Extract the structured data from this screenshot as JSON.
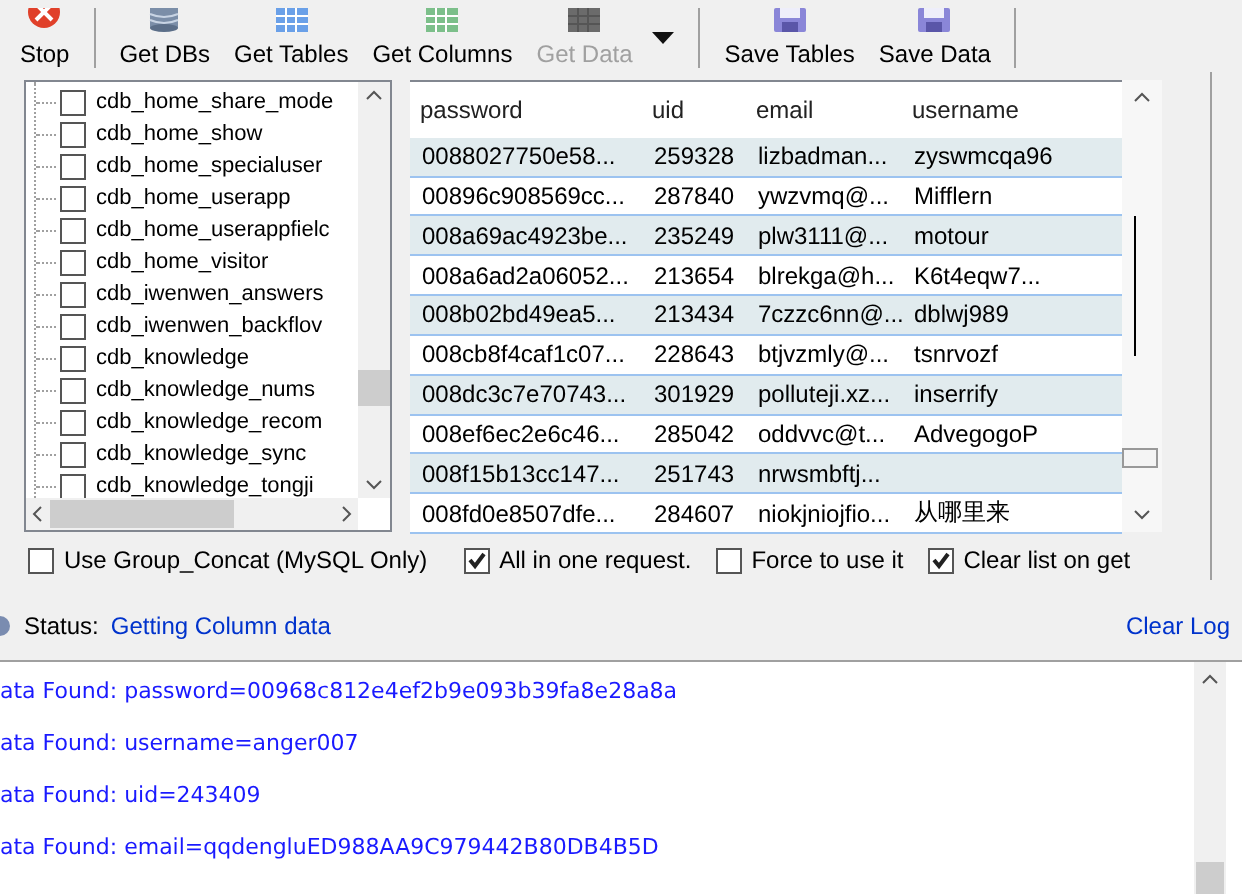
{
  "toolbar": {
    "buttons": [
      {
        "label": "Stop",
        "disabled": false
      },
      {
        "label": "Get DBs",
        "disabled": false
      },
      {
        "label": "Get Tables",
        "disabled": false
      },
      {
        "label": "Get Columns",
        "disabled": false
      },
      {
        "label": "Get Data",
        "disabled": true
      },
      {
        "label": "Save Tables",
        "disabled": false
      },
      {
        "label": "Save Data",
        "disabled": false
      }
    ]
  },
  "tree": {
    "items": [
      {
        "label": "cdb_home_share_mode",
        "checked": false
      },
      {
        "label": "cdb_home_show",
        "checked": false
      },
      {
        "label": "cdb_home_specialuser",
        "checked": false
      },
      {
        "label": "cdb_home_userapp",
        "checked": false
      },
      {
        "label": "cdb_home_userappfielc",
        "checked": false
      },
      {
        "label": "cdb_home_visitor",
        "checked": false
      },
      {
        "label": "cdb_iwenwen_answers",
        "checked": false
      },
      {
        "label": "cdb_iwenwen_backflov",
        "checked": false
      },
      {
        "label": "cdb_knowledge",
        "checked": false
      },
      {
        "label": "cdb_knowledge_nums",
        "checked": false
      },
      {
        "label": "cdb_knowledge_recom",
        "checked": false
      },
      {
        "label": "cdb_knowledge_sync",
        "checked": false
      },
      {
        "label": "cdb_knowledge_tongji",
        "checked": false
      }
    ]
  },
  "group_concat": {
    "label": "Use Group_Concat (MySQL Only)",
    "checked": false
  },
  "grid": {
    "columns": [
      "password",
      "uid",
      "email",
      "username"
    ],
    "rows": [
      [
        "0088027750e58...",
        "259328",
        "lizbadman...",
        "zyswmcqa96"
      ],
      [
        "00896c908569cc...",
        "287840",
        "ywzvmq@...",
        "Mifflern"
      ],
      [
        "008a69ac4923be...",
        "235249",
        "plw3111@...",
        "motour"
      ],
      [
        "008a6ad2a06052...",
        "213654",
        "blrekga@h...",
        "K6t4eqw7..."
      ],
      [
        "008b02bd49ea5...",
        "213434",
        "7czzc6nn@...",
        "dblwj989"
      ],
      [
        "008cb8f4caf1c07...",
        "228643",
        "btjvzmly@...",
        "tsnrvozf"
      ],
      [
        "008dc3c7e70743...",
        "301929",
        "polluteji.xz...",
        "inserrify"
      ],
      [
        "008ef6ec2e6c46...",
        "285042",
        "oddvvc@t...",
        "AdvegogoP"
      ],
      [
        "008f15b13cc147...",
        "251743",
        "nrwsmbftj...",
        ""
      ],
      [
        "008fd0e8507dfe...",
        "284607",
        "niokjniojfio...",
        "从哪里来"
      ]
    ]
  },
  "options": [
    {
      "label": "All in one request.",
      "checked": true
    },
    {
      "label": "Force to use it",
      "checked": false
    },
    {
      "label": "Clear list on get",
      "checked": true
    }
  ],
  "status": {
    "label": "Status:",
    "value": "Getting Column data",
    "clear_log": "Clear Log"
  },
  "log": [
    "ata Found: password=00968c812e4ef2b9e093b39fa8e28a8a",
    "ata Found: username=anger007",
    "ata Found: uid=243409",
    "ata Found: email=qqdengluED988AA9C979442B80DB4B5D"
  ]
}
